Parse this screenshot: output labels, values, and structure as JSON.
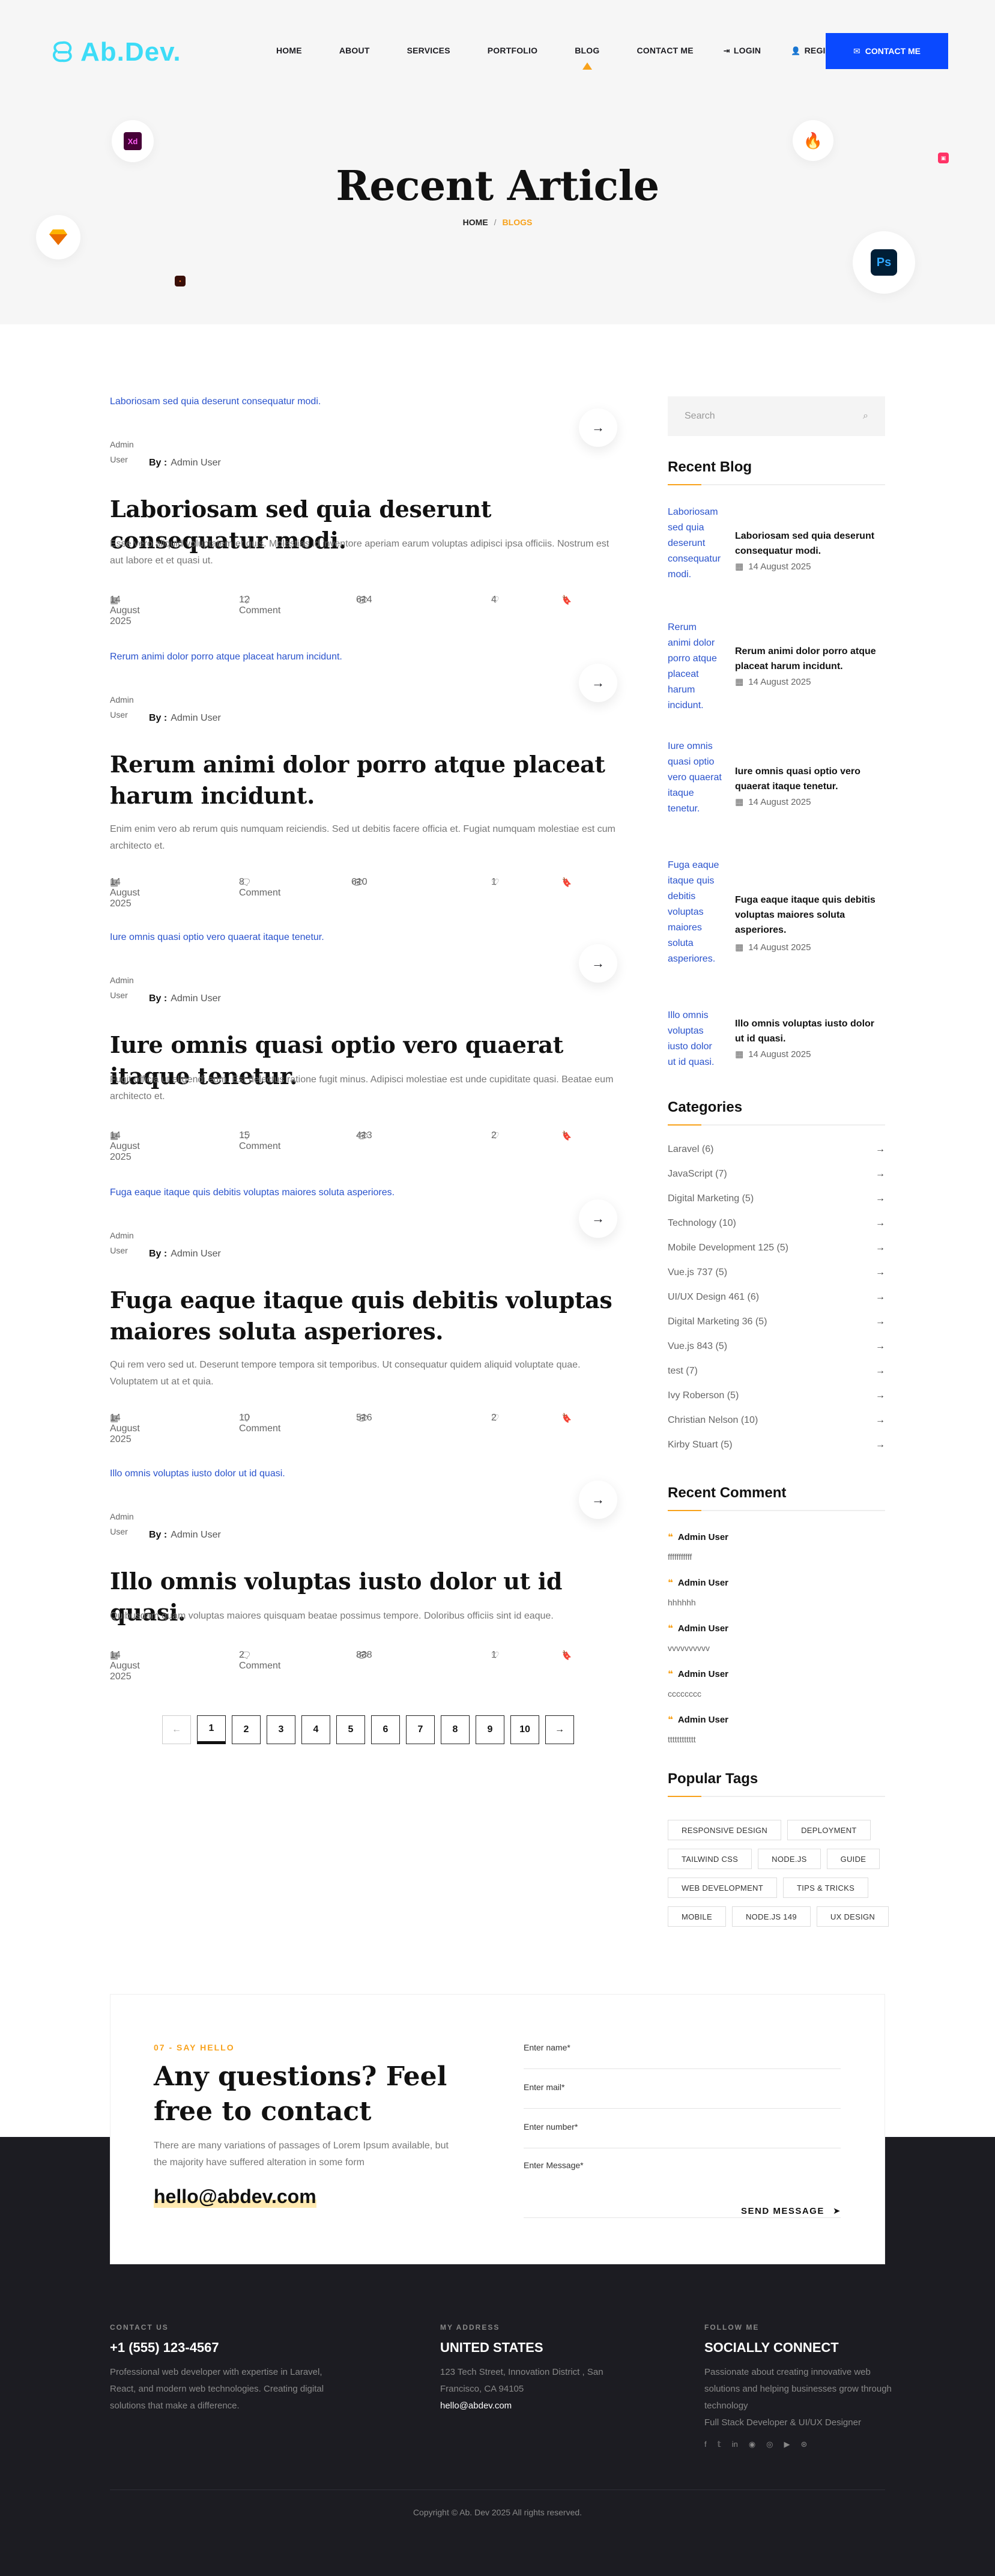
{
  "brand": {
    "logo_text": "Ab.Dev.",
    "accent": "#f8a21b",
    "primary": "#0a49ff",
    "logo_color": "#3ddcf7"
  },
  "nav": {
    "items": [
      "HOME",
      "ABOUT",
      "SERVICES",
      "PORTFOLIO",
      "BLOG",
      "CONTACT ME"
    ],
    "login": "LOGIN",
    "register": "REGISTER",
    "cta": "CONTACT ME"
  },
  "hero": {
    "title": "Recent Article",
    "crumb_home": "HOME",
    "crumb_sep": "/",
    "crumb_current": "BLOGS",
    "icons": [
      "Xd",
      "Ps"
    ]
  },
  "posts": [
    {
      "image_alt": "Laboriosam sed quia deserunt consequatur modi.",
      "author_alt": "Admin User",
      "by_label": "By :",
      "author": "Admin User",
      "title": "Laboriosam sed quia deserunt consequatur modi.",
      "excerpt": "Esse vero aliquid voluptatem et quis. Molestias id inventore aperiam earum voluptas adipisci ipsa officiis. Nostrum est aut labore et et quasi ut.",
      "date": "14 August 2025",
      "comments": "12 Comment",
      "views": "614",
      "likes": "4"
    },
    {
      "image_alt": "Rerum animi dolor porro atque placeat harum incidunt.",
      "author_alt": "Admin User",
      "by_label": "By :",
      "author": "Admin User",
      "title": "Rerum animi dolor porro atque placeat harum incidunt.",
      "excerpt": "Enim enim vero ab rerum quis numquam reiciendis. Sed ut debitis facere officia et. Fugiat numquam molestiae est cum architecto et.",
      "date": "14 August 2025",
      "comments": "8 Comment",
      "views": "610",
      "likes": "1"
    },
    {
      "image_alt": "Iure omnis quasi optio vero quaerat itaque tenetur.",
      "author_alt": "Admin User",
      "by_label": "By :",
      "author": "Admin User",
      "title": "Iure omnis quasi optio vero quaerat itaque tenetur.",
      "excerpt": "Fugit officia ut eligendi eum. Est delectus ratione fugit minus. Adipisci molestiae est unde cupiditate quasi. Beatae eum architecto et.",
      "date": "14 August 2025",
      "comments": "15 Comment",
      "views": "413",
      "likes": "2"
    },
    {
      "image_alt": "Fuga eaque itaque quis debitis voluptas maiores soluta asperiores.",
      "author_alt": "Admin User",
      "by_label": "By :",
      "author": "Admin User",
      "title": "Fuga eaque itaque quis debitis voluptas maiores soluta asperiores.",
      "excerpt": "Qui rem vero sed ut. Deserunt tempore tempora sit temporibus. Ut consequatur quidem aliquid voluptate quae. Voluptatem ut at et quia.",
      "date": "14 August 2025",
      "comments": "10 Comment",
      "views": "516",
      "likes": "2"
    },
    {
      "image_alt": "Illo omnis voluptas iusto dolor ut id quasi.",
      "author_alt": "Admin User",
      "by_label": "By :",
      "author": "Admin User",
      "title": "Illo omnis voluptas iusto dolor ut id quasi.",
      "excerpt": "Quibusdam quam voluptas maiores quisquam beatae possimus tempore. Doloribus officiis sint id eaque.",
      "date": "14 August 2025",
      "comments": "2 Comment",
      "views": "838",
      "likes": "1"
    }
  ],
  "pagination": {
    "prev": "←",
    "pages": [
      "1",
      "2",
      "3",
      "4",
      "5",
      "6",
      "7",
      "8",
      "9",
      "10"
    ],
    "next": "→",
    "current": "1"
  },
  "sidebar": {
    "search_placeholder": "Search",
    "recent_title": "Recent Blog",
    "recent": [
      {
        "alt": "Laboriosam sed quia deserunt consequatur modi.",
        "title": "Laboriosam sed quia deserunt consequatur modi.",
        "date": "14 August 2025"
      },
      {
        "alt": "Rerum animi dolor porro atque placeat harum incidunt.",
        "title": "Rerum animi dolor porro atque placeat harum incidunt.",
        "date": "14 August 2025"
      },
      {
        "alt": "Iure omnis quasi optio vero quaerat itaque tenetur.",
        "title": "Iure omnis quasi optio vero quaerat itaque tenetur.",
        "date": "14 August 2025"
      },
      {
        "alt": "Fuga eaque itaque quis debitis voluptas maiores soluta asperiores.",
        "title": "Fuga eaque itaque quis debitis voluptas maiores soluta asperiores.",
        "date": "14 August 2025"
      },
      {
        "alt": "Illo omnis voluptas iusto dolor ut id quasi.",
        "title": "Illo omnis voluptas iusto dolor ut id quasi.",
        "date": "14 August 2025"
      }
    ],
    "categories_title": "Categories",
    "categories": [
      "Laravel (6)",
      "JavaScript (7)",
      "Digital Marketing (5)",
      "Technology (10)",
      "Mobile Development 125 (5)",
      "Vue.js 737 (5)",
      "UI/UX Design 461 (6)",
      "Digital Marketing 36 (5)",
      "Vue.js 843 (5)",
      "test (7)",
      "Ivy Roberson (5)",
      "Christian Nelson (10)",
      "Kirby Stuart (5)"
    ],
    "comments_title": "Recent Comment",
    "comments": [
      {
        "name": "Admin User",
        "text": "fffffffffff"
      },
      {
        "name": "Admin User",
        "text": "hhhhhh"
      },
      {
        "name": "Admin User",
        "text": "vvvvvvvvvv"
      },
      {
        "name": "Admin User",
        "text": "cccccccc"
      },
      {
        "name": "Admin User",
        "text": "tttttttttttt"
      }
    ],
    "tags_title": "Popular Tags",
    "tags": [
      "RESPONSIVE DESIGN",
      "DEPLOYMENT",
      "TAILWIND CSS",
      "NODE.JS",
      "GUIDE",
      "WEB DEVELOPMENT",
      "TIPS & TRICKS",
      "MOBILE",
      "NODE.JS 149",
      "UX DESIGN"
    ]
  },
  "contact": {
    "kicker": "07 - SAY HELLO",
    "heading": "Any questions? Feel free to contact",
    "text": "There are many variations of passages of Lorem Ipsum available, but the majority have suffered alteration in some form",
    "email": "hello@abdev.com",
    "fields": [
      "Enter name*",
      "Enter mail*",
      "Enter number*",
      "Enter Message*"
    ],
    "send": "SEND MESSAGE"
  },
  "footer": {
    "col1": {
      "kicker": "CONTACT US",
      "heading": "+1 (555) 123-4567",
      "text": "Professional web developer with expertise in Laravel, React, and modern web technologies. Creating digital solutions that make a difference."
    },
    "col2": {
      "kicker": "MY ADDRESS",
      "heading": "UNITED STATES",
      "text": "123 Tech Street, Innovation District , San Francisco, CA 94105",
      "email": "hello@abdev.com"
    },
    "col3": {
      "kicker": "FOLLOW ME",
      "heading": "SOCIALLY CONNECT",
      "text": "Passionate about creating innovative web solutions and helping businesses grow through technology",
      "role": "Full Stack Developer & UI/UX Designer",
      "social_icons": [
        "facebook-icon",
        "twitter-icon",
        "linkedin-icon",
        "github-icon",
        "instagram-icon",
        "youtube-icon",
        "dribbble-icon"
      ]
    },
    "copyright": "Copyright © Ab. Dev 2025 All rights reserved."
  }
}
